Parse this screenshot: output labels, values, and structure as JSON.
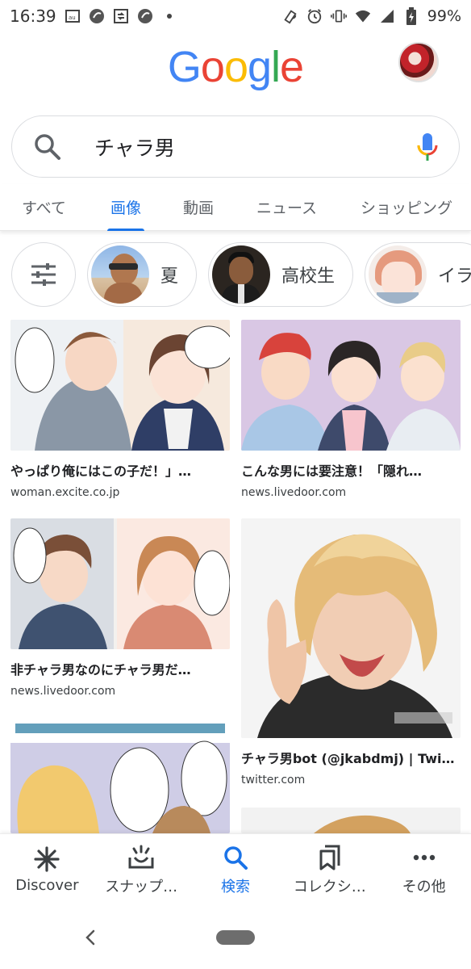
{
  "status_bar": {
    "time": "16:39",
    "battery": "99%",
    "left_icons": [
      "au-icon",
      "app-circle-icon",
      "cast-icon",
      "app-circle-icon",
      "dot-icon"
    ],
    "right_icons": [
      "nfc-icon",
      "alarm-icon",
      "vibrate-icon",
      "wifi-icon",
      "signal-icon",
      "battery-icon"
    ]
  },
  "header": {
    "logo": {
      "letters": [
        "G",
        "o",
        "o",
        "g",
        "l",
        "e"
      ],
      "colors": [
        "#4285F4",
        "#EA4335",
        "#FBBC05",
        "#4285F4",
        "#34A853",
        "#EA4335"
      ]
    }
  },
  "search": {
    "query": "チャラ男"
  },
  "tabs": [
    {
      "label": "すべて",
      "active": false
    },
    {
      "label": "画像",
      "active": true
    },
    {
      "label": "動画",
      "active": false
    },
    {
      "label": "ニュース",
      "active": false
    },
    {
      "label": "ショッピング",
      "active": false
    }
  ],
  "chips": [
    {
      "label": "夏"
    },
    {
      "label": "高校生"
    },
    {
      "label": "イラ"
    }
  ],
  "results": [
    {
      "title": "やっぱり俺にはこの子だ！」…",
      "domain": "woman.excite.co.jp"
    },
    {
      "title": "こんな男には要注意！「隠れ…",
      "domain": "news.livedoor.com"
    },
    {
      "title": "非チャラ男なのにチャラ男だ…",
      "domain": "news.livedoor.com"
    },
    {
      "title": "チャラ男bot (@jkabdmj) | Twi…",
      "domain": "twitter.com"
    }
  ],
  "bottom_nav": [
    {
      "label": "Discover",
      "icon": "asterisk-icon",
      "active": false
    },
    {
      "label": "スナップ…",
      "icon": "snapshot-icon",
      "active": false
    },
    {
      "label": "検索",
      "icon": "search-icon",
      "active": true
    },
    {
      "label": "コレクシ…",
      "icon": "bookmark-icon",
      "active": false
    },
    {
      "label": "その他",
      "icon": "more-icon",
      "active": false
    }
  ],
  "colors": {
    "accent": "#1a73e8",
    "text": "#202124",
    "muted": "#5f6368"
  }
}
